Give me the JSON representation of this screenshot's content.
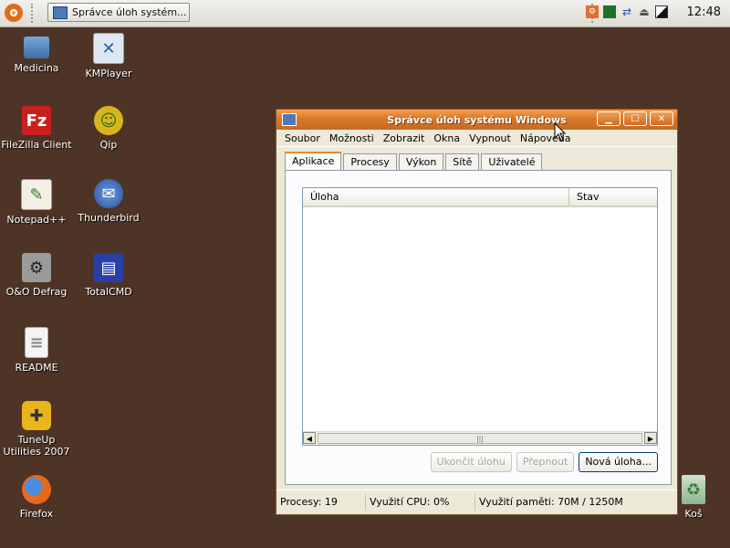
{
  "panel": {
    "task_label": "Správce úloh systém...",
    "clock": "12:48"
  },
  "desktop_icons": [
    {
      "label": "Medicina",
      "icon": "folder-icon"
    },
    {
      "label": "KMPlayer",
      "icon": "kmplayer-icon"
    },
    {
      "label": "FileZilla Client",
      "icon": "filezilla-icon"
    },
    {
      "label": "Qip",
      "icon": "qip-icon"
    },
    {
      "label": "Notepad++",
      "icon": "notepad-icon"
    },
    {
      "label": "Thunderbird",
      "icon": "thunderbird-icon"
    },
    {
      "label": "O&O Defrag",
      "icon": "defrag-icon"
    },
    {
      "label": "TotalCMD",
      "icon": "floppy-icon"
    },
    {
      "label": "README",
      "icon": "document-icon"
    },
    {
      "label": "TuneUp Utilities 2007",
      "icon": "tuneup-icon"
    },
    {
      "label": "Firefox",
      "icon": "firefox-icon"
    },
    {
      "label": "Koš",
      "icon": "trash-icon"
    }
  ],
  "window": {
    "title": "Správce úloh systému Windows",
    "menu": [
      "Soubor",
      "Možnosti",
      "Zobrazit",
      "Okna",
      "Vypnout",
      "Nápověda"
    ],
    "tabs": [
      "Aplikace",
      "Procesy",
      "Výkon",
      "Sítě",
      "Uživatelé"
    ],
    "columns": [
      "Úloha",
      "Stav"
    ],
    "buttons": {
      "end_task": "Ukončit úlohu",
      "switch_to": "Přepnout",
      "new_task": "Nová úloha..."
    },
    "status": {
      "processes": "Procesy: 19",
      "cpu": "Využití CPU: 0%",
      "memory": "Využití paměti: 70M / 1250M"
    }
  }
}
